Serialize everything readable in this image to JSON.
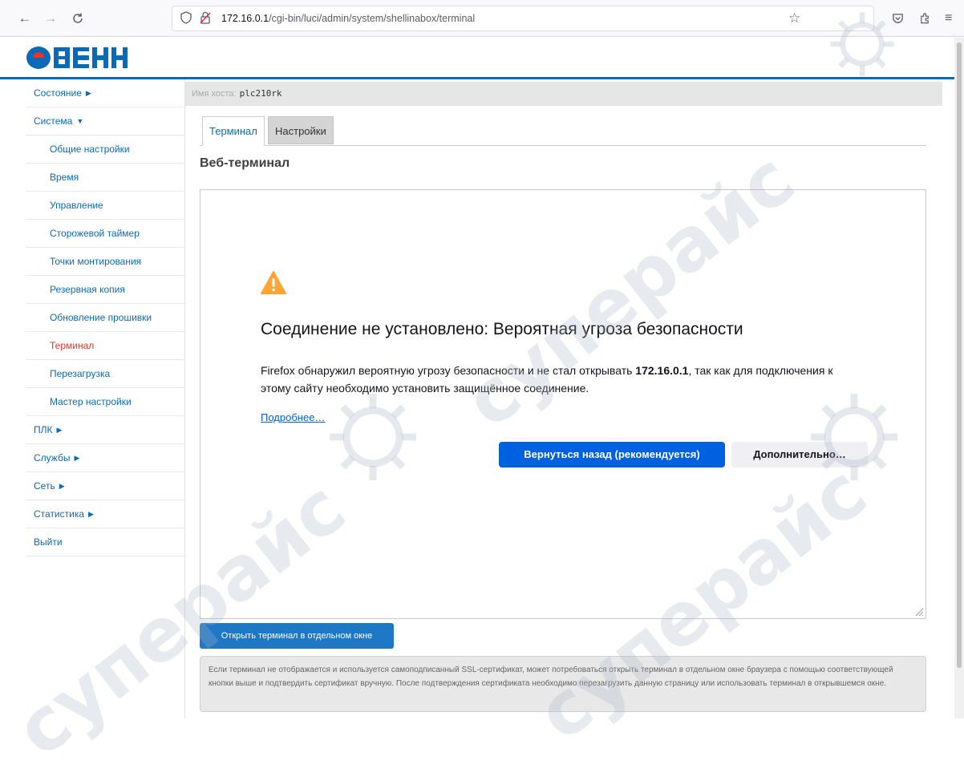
{
  "browser": {
    "url_host": "172.16.0.1",
    "url_path": "/cgi-bin/luci/admin/system/shellinabox/terminal",
    "icons": [
      "back-arrow-icon",
      "forward-arrow-icon",
      "reload-icon",
      "shield-icon",
      "insecure-lock-icon",
      "bookmark-star-icon",
      "pocket-icon",
      "extensions-icon",
      "menu-icon"
    ]
  },
  "logo": {
    "text": "ОВЕН",
    "color": "#0a6ab6",
    "accent": "#e8332a"
  },
  "sidebar": {
    "items": [
      {
        "label": "Состояние",
        "caret": "▶"
      },
      {
        "label": "Система",
        "caret": "▼"
      },
      {
        "label": "Общие настройки"
      },
      {
        "label": "Время"
      },
      {
        "label": "Управление"
      },
      {
        "label": "Сторожевой таймер"
      },
      {
        "label": "Точки монтирования"
      },
      {
        "label": "Резервная копия"
      },
      {
        "label": "Обновление прошивки"
      },
      {
        "label": "Терминал"
      },
      {
        "label": "Перезагрузка"
      },
      {
        "label": "Мастер настройки"
      },
      {
        "label": "ПЛК",
        "caret": "▶"
      },
      {
        "label": "Службы",
        "caret": "▶"
      },
      {
        "label": "Сеть",
        "caret": "▶"
      },
      {
        "label": "Статистика",
        "caret": "▶"
      },
      {
        "label": "Выйти"
      }
    ]
  },
  "hostbar": {
    "label": "Имя хоста:",
    "value": "plc210rk"
  },
  "tabs": [
    {
      "label": "Терминал"
    },
    {
      "label": "Настройки"
    }
  ],
  "section_title": "Веб-терминал",
  "error_page": {
    "title": "Соединение не установлено: Вероятная угроза безопасности",
    "text_before": "Firefox обнаружил вероятную угрозу безопасности и не стал открывать ",
    "host": "172.16.0.1",
    "text_after": ", так как для подключения к этому сайту необходимо установить защищённое соединение.",
    "more_link": "Подробнее…",
    "back_button": "Вернуться назад (рекомендуется)",
    "advanced_button": "Дополнительно…"
  },
  "open_window_button": "Открыть терминал в отдельном окне",
  "note": "Если терминал не отображается и используется самоподписанный SSL-сертификат, может потребоваться открыть терминал в отдельном окне браузера с помощью соответствующей кнопки выше и подтвердить сертификат вручную. После подтверждения сертификата необходимо перезагрузить данную страницу или использовать терминал в открывшемся окне.",
  "watermark": "суперайс"
}
